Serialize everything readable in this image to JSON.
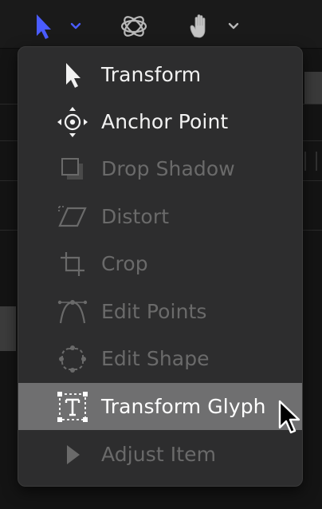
{
  "toolbar": {
    "tools": [
      {
        "icon": "select-arrow-icon",
        "active": true,
        "has_menu": true
      },
      {
        "icon": "orbit-icon",
        "active": false,
        "has_menu": false
      },
      {
        "icon": "hand-icon",
        "active": false,
        "has_menu": true
      }
    ],
    "accent_color": "#4a5cff"
  },
  "menu": {
    "items": [
      {
        "label": "Transform",
        "icon": "arrow-cursor-icon",
        "enabled": true,
        "highlighted": false
      },
      {
        "label": "Anchor Point",
        "icon": "anchor-point-icon",
        "enabled": true,
        "highlighted": false
      },
      {
        "label": "Drop Shadow",
        "icon": "drop-shadow-icon",
        "enabled": false,
        "highlighted": false
      },
      {
        "label": "Distort",
        "icon": "distort-icon",
        "enabled": false,
        "highlighted": false
      },
      {
        "label": "Crop",
        "icon": "crop-icon",
        "enabled": false,
        "highlighted": false
      },
      {
        "label": "Edit Points",
        "icon": "edit-points-icon",
        "enabled": false,
        "highlighted": false
      },
      {
        "label": "Edit Shape",
        "icon": "edit-shape-icon",
        "enabled": false,
        "highlighted": false
      },
      {
        "label": "Transform Glyph",
        "icon": "transform-glyph-icon",
        "enabled": true,
        "highlighted": true
      },
      {
        "label": "Adjust Item",
        "icon": "adjust-item-icon",
        "enabled": false,
        "highlighted": false
      }
    ]
  },
  "colors": {
    "menu_background": "#2d2d2e",
    "highlight": "#6f6f70",
    "enabled_text": "#f2f2f2",
    "disabled_text": "#6a6a6a"
  }
}
